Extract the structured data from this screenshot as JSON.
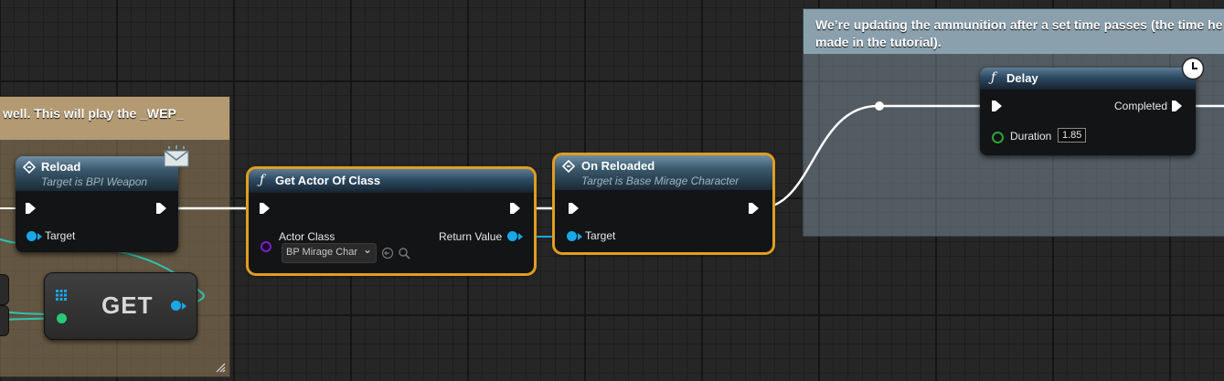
{
  "comments": {
    "left_text": "well. This will play the _WEP_",
    "right_text": "We’re updating the ammunition after a set time passes (the time he made in the tutorial)."
  },
  "reload_node": {
    "title": "Reload",
    "subtitle": "Target is BPI Weapon",
    "target_label": "Target"
  },
  "get_node": {
    "label": "GET"
  },
  "get_actor_node": {
    "title": "Get Actor Of Class",
    "actor_class_label": "Actor Class",
    "actor_class_value": "BP Mirage Char",
    "return_value_label": "Return Value"
  },
  "on_reloaded_node": {
    "title": "On Reloaded",
    "subtitle": "Target is Base Mirage Character",
    "target_label": "Target"
  },
  "delay_node": {
    "title": "Delay",
    "completed_label": "Completed",
    "duration_label": "Duration",
    "duration_value": "1.85"
  },
  "icons": {
    "function": "ƒ",
    "chevron": "⌄"
  },
  "colors": {
    "exec_wire": "#ffffff",
    "object_wire": "#1aa7e8",
    "selection": "#e09e1f",
    "teal_wire": "#2ec4b0"
  }
}
